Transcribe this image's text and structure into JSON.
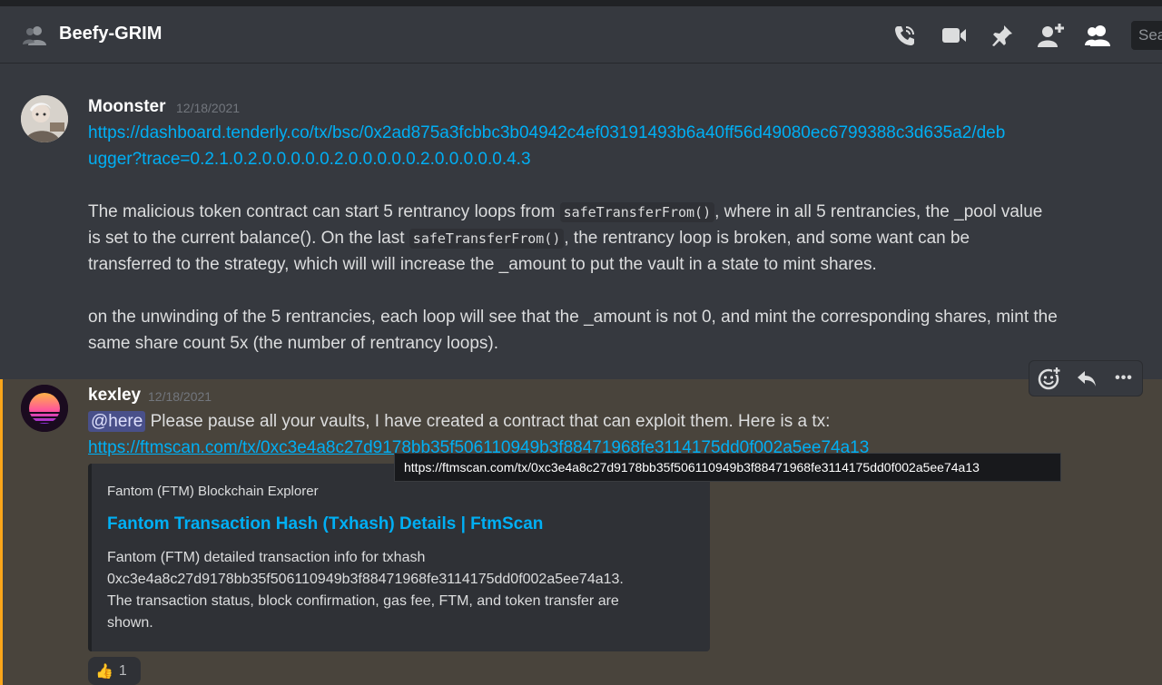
{
  "header": {
    "channel_name": "Beefy-GRIM",
    "search_placeholder": "Sea",
    "icons": [
      "people-icon",
      "call-icon",
      "video-icon",
      "pin-icon",
      "add-member-icon",
      "member-list-icon"
    ]
  },
  "messages": [
    {
      "author": "Moonster",
      "timestamp": "12/18/2021",
      "link_line1": "https://dashboard.tenderly.co/tx/bsc/0x2ad875a3fcbbc3b04942c4ef03191493b6a40ff56d49080ec6799388c3d635a2/deb",
      "link_line2": "ugger?trace=0.2.1.0.2.0.0.0.0.0.2.0.0.0.0.0.2.0.0.0.0.0.4.3",
      "p1_l1_a": "The malicious token contract can start 5 rentrancy loops from ",
      "p1_l1_code": "safeTransferFrom()",
      "p1_l1_b": ", where in all 5 rentrancies, the _pool value",
      "p1_l2_a": "is set to the current balance(). On the last ",
      "p1_l2_code": "safeTransferFrom()",
      "p1_l2_b": ", the rentrancy loop is broken, and some want can be",
      "p1_l3": "transferred to the strategy, which will will increase the _amount to put the vault in a state to mint shares.",
      "p2_l1": "on the unwinding of the 5 rentrancies, each loop will see that the _amount is not 0, and mint the corresponding shares, mint the",
      "p2_l2": "same share count 5x (the number of rentrancy loops)."
    },
    {
      "author": "kexley",
      "timestamp": "12/18/2021",
      "mention": "@here",
      "text": " Please pause all your vaults, I have created a contract that can exploit them. Here is a tx:",
      "link": "https://ftmscan.com/tx/0xc3e4a8c27d9178bb35f506110949b3f88471968fe3114175dd0f002a5ee74a13",
      "embed": {
        "provider": "Fantom (FTM) Blockchain Explorer",
        "title": "Fantom Transaction Hash (Txhash) Details | FtmScan",
        "desc1": "Fantom (FTM) detailed transaction info for txhash",
        "desc2": "0xc3e4a8c27d9178bb35f506110949b3f88471968fe3114175dd0f002a5ee74a13.",
        "desc3": "The transaction status, block confirmation, gas fee, FTM, and token transfer are",
        "desc4": "shown."
      },
      "reaction": {
        "emoji": "👍",
        "count": "1"
      }
    }
  ],
  "tooltip": "https://ftmscan.com/tx/0xc3e4a8c27d9178bb35f506110949b3f88471968fe3114175dd0f002a5ee74a13",
  "hover_toolbar": {
    "icons": [
      "add-reaction-icon",
      "reply-icon",
      "more-icon"
    ],
    "more_label": "•••"
  },
  "colors": {
    "background": "#36393f",
    "link": "#00aff4",
    "mention_highlight": "#49443c",
    "mention_bar": "#faa61a"
  }
}
